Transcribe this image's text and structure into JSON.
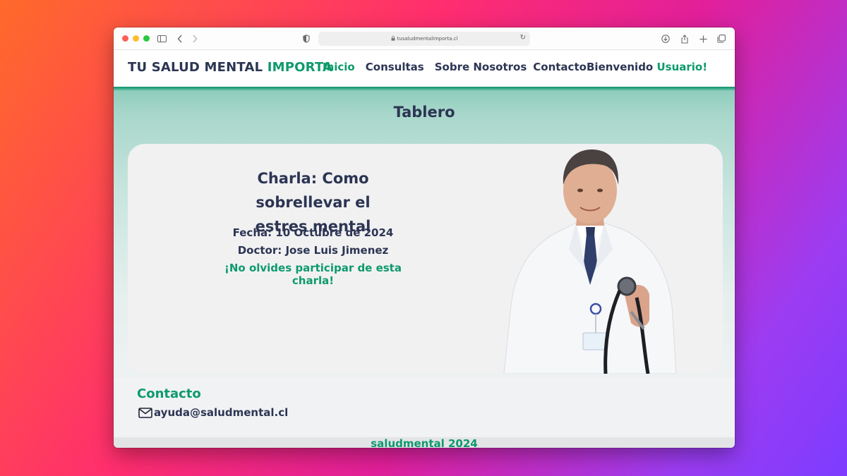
{
  "browser": {
    "url": "tusaludmentalimporta.cl"
  },
  "header": {
    "logo_main": "TU SALUD MENTAL",
    "logo_accent": "IMPORTA",
    "nav": [
      {
        "label": "Inicio",
        "active": true
      },
      {
        "label": "Consultas",
        "active": false
      },
      {
        "label": "Sobre Nosotros",
        "active": false
      },
      {
        "label": "Contacto",
        "active": false
      }
    ],
    "welcome_prefix": "Bienvenido",
    "welcome_user": "Usuario!"
  },
  "main": {
    "title": "Tablero",
    "event": {
      "title_line1": "Charla: Como sobrellevar el",
      "title_line2": "estres mental",
      "date": "Fecha: 10 Octubre de 2024",
      "doctor": "Doctor: Jose Luis Jimenez",
      "reminder": "¡No olvides participar de esta charla!"
    }
  },
  "contact": {
    "title": "Contacto",
    "email": "ayuda@saludmental.cl"
  },
  "footer": {
    "text": "saludmental 2024"
  },
  "colors": {
    "brand_dark": "#2c3553",
    "brand_green": "#0e9a6c",
    "header_band": "#a9d7cb"
  }
}
